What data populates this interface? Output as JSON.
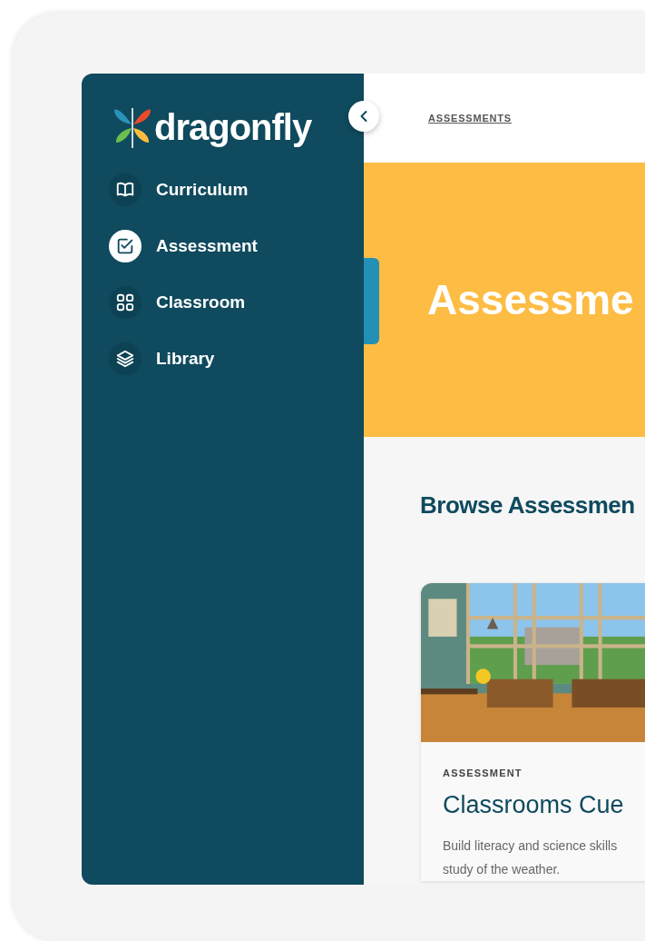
{
  "brand": "dragonfly",
  "sidebar": {
    "items": [
      {
        "label": "Curriculum",
        "selected": false
      },
      {
        "label": "Assessment",
        "selected": true
      },
      {
        "label": "Classroom",
        "selected": false
      },
      {
        "label": "Library",
        "selected": false
      }
    ]
  },
  "breadcrumb": "ASSESSMENTS",
  "banner": {
    "title": "Assessme"
  },
  "section_title": "Browse Assessmen",
  "cards": [
    {
      "eyebrow": "ASSESSMENT",
      "title": "Classrooms Cue",
      "description": [
        "Build literacy and science skills",
        "study of the weather."
      ]
    }
  ]
}
